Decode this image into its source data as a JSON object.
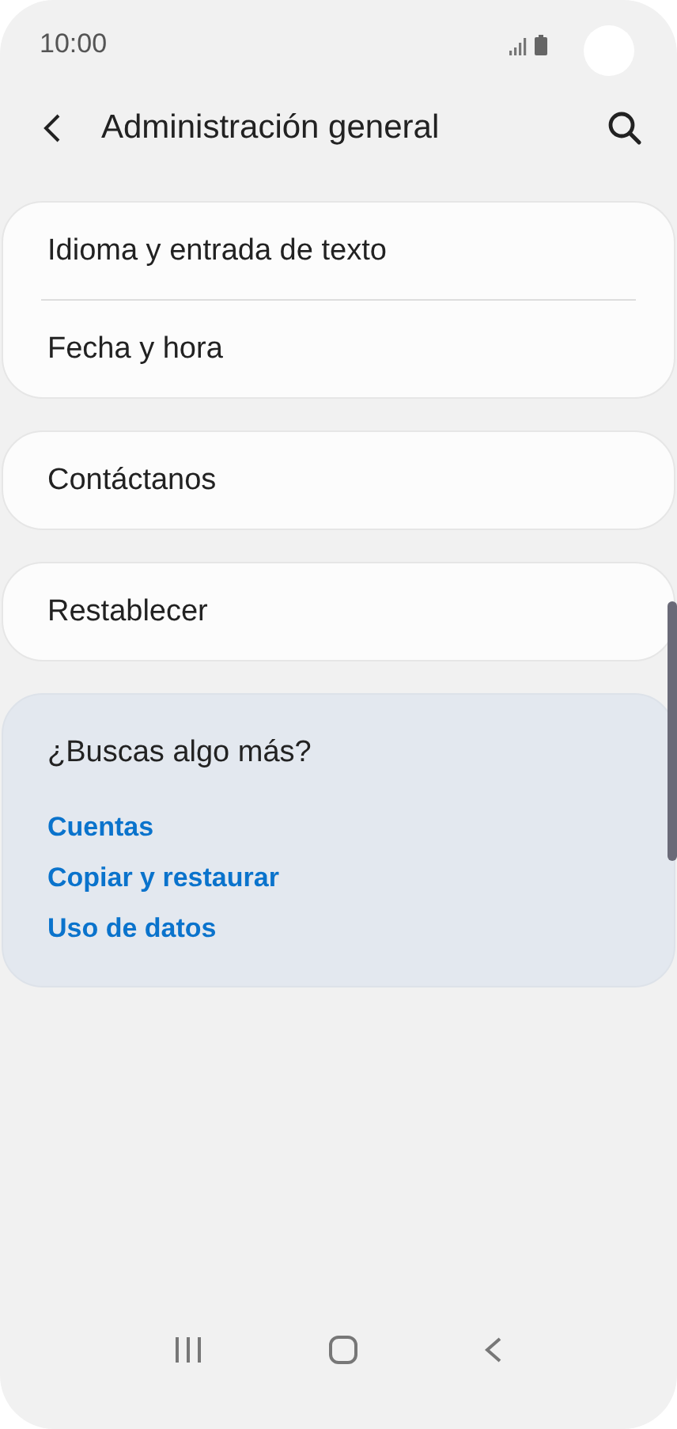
{
  "status_bar": {
    "time": "10:00"
  },
  "header": {
    "title": "Administración general"
  },
  "groups": [
    {
      "items": [
        "Idioma y entrada de texto",
        "Fecha y hora"
      ]
    },
    {
      "items": [
        "Contáctanos"
      ]
    },
    {
      "items": [
        "Restablecer"
      ]
    }
  ],
  "suggestions": {
    "title": "¿Buscas algo más?",
    "links": [
      "Cuentas",
      "Copiar y restaurar",
      "Uso de datos"
    ]
  }
}
